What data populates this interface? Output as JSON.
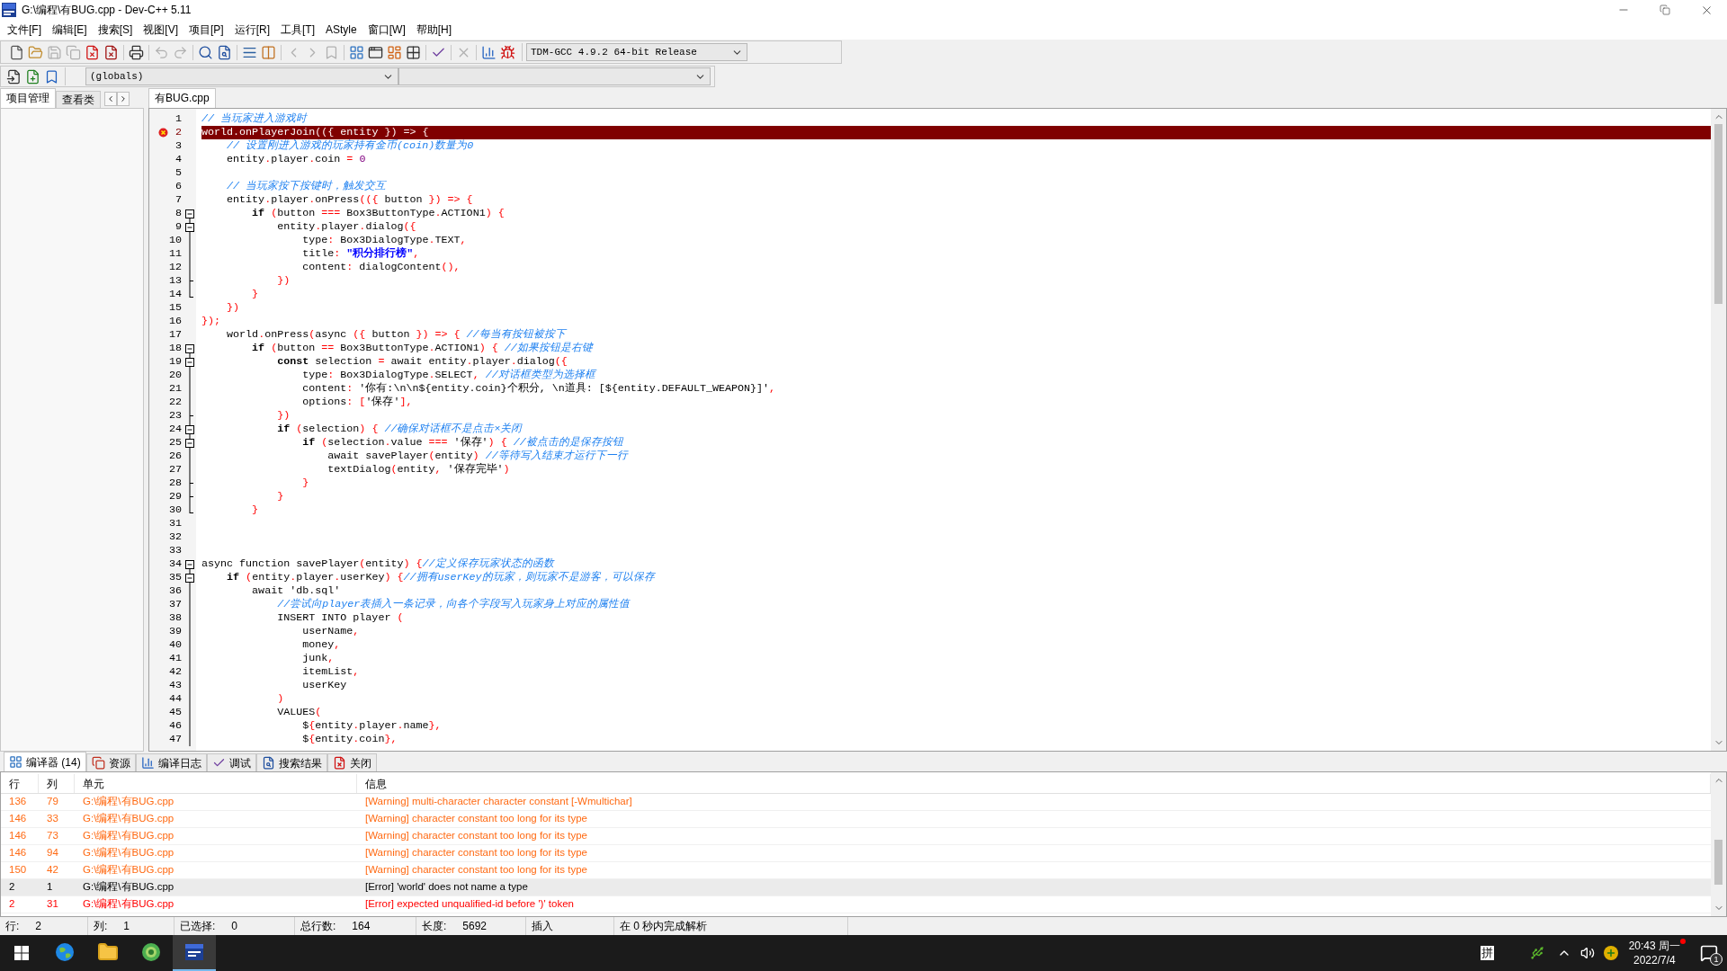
{
  "window": {
    "title": "G:\\编程\\有BUG.cpp - Dev-C++ 5.11"
  },
  "menu": [
    "文件[F]",
    "编辑[E]",
    "搜索[S]",
    "视图[V]",
    "项目[P]",
    "运行[R]",
    "工具[T]",
    "AStyle",
    "窗口[W]",
    "帮助[H]"
  ],
  "toolbar_1": [
    [
      {
        "kind": "new",
        "disabled": false
      },
      {
        "kind": "open",
        "disabled": false
      },
      {
        "kind": "save",
        "disabled": true
      },
      {
        "kind": "save-all",
        "disabled": true
      },
      {
        "kind": "close",
        "disabled": false
      },
      {
        "kind": "close-all",
        "disabled": false
      }
    ],
    [
      {
        "kind": "print",
        "disabled": false
      }
    ],
    [
      {
        "kind": "undo",
        "disabled": true
      },
      {
        "kind": "redo",
        "disabled": true
      }
    ],
    [
      {
        "kind": "find",
        "disabled": false
      },
      {
        "kind": "replace",
        "disabled": false
      }
    ],
    [
      {
        "kind": "indent",
        "disabled": false
      },
      {
        "kind": "unindent",
        "disabled": false
      }
    ],
    [
      {
        "kind": "prev",
        "disabled": true
      },
      {
        "kind": "next",
        "disabled": true
      },
      {
        "kind": "bookmark",
        "disabled": true
      }
    ],
    [
      {
        "kind": "grid",
        "disabled": false
      },
      {
        "kind": "window",
        "disabled": false
      },
      {
        "kind": "dashboard",
        "disabled": false
      },
      {
        "kind": "tiles",
        "disabled": false
      }
    ],
    [
      {
        "kind": "check",
        "disabled": false
      }
    ],
    [
      {
        "kind": "delete",
        "disabled": true
      }
    ],
    [
      {
        "kind": "chart",
        "disabled": false
      },
      {
        "kind": "stop",
        "disabled": false
      }
    ]
  ],
  "compiler_select": {
    "value": "TDM-GCC 4.9.2 64-bit Release"
  },
  "toolbar_2": [
    {
      "kind": "insert",
      "disabled": false
    },
    {
      "kind": "toggle-bookmark",
      "disabled": false
    },
    {
      "kind": "goto-bookmark",
      "disabled": false
    }
  ],
  "scope_select": {
    "value": "(globals)"
  },
  "left_panel": {
    "tabs": [
      {
        "label": "项目管理",
        "selected": true
      },
      {
        "label": "查看类",
        "selected": false
      }
    ]
  },
  "editor_tabs": [
    {
      "label": "有BUG.cpp",
      "selected": true
    }
  ],
  "editor": {
    "lines": [
      {
        "number": "1",
        "kind": "plain",
        "error": false,
        "segments": [
          {
            "kind": "comment",
            "text": "// 当玩家进入游戏时"
          }
        ]
      },
      {
        "number": "2",
        "kind": "plain",
        "error": true,
        "segments": [
          {
            "kind": "text",
            "text": "world"
          },
          {
            "kind": "punct",
            "text": "."
          },
          {
            "kind": "text",
            "text": "onPlayerJoin"
          },
          {
            "kind": "punct",
            "text": "(({"
          },
          {
            "kind": "text",
            "text": " entity "
          },
          {
            "kind": "punct",
            "text": "}) => {"
          }
        ]
      },
      {
        "number": "3",
        "kind": "plain",
        "error": false,
        "segments": [
          {
            "kind": "comment",
            "text": "    // 设置刚进入游戏的玩家持有金币(coin)数量为0"
          }
        ]
      },
      {
        "number": "4",
        "kind": "plain",
        "error": false,
        "segments": [
          {
            "kind": "text",
            "text": "    entity"
          },
          {
            "kind": "punct",
            "text": "."
          },
          {
            "kind": "text",
            "text": "player"
          },
          {
            "kind": "punct",
            "text": "."
          },
          {
            "kind": "text",
            "text": "coin "
          },
          {
            "kind": "punct",
            "text": "= "
          },
          {
            "kind": "number",
            "text": "0"
          }
        ]
      },
      {
        "number": "5",
        "kind": "plain",
        "error": false
      },
      {
        "number": "6",
        "kind": "plain",
        "error": false,
        "segments": [
          {
            "kind": "comment",
            "text": "    // 当玩家按下按键时，触发交互"
          }
        ]
      },
      {
        "number": "7",
        "kind": "plain",
        "error": false,
        "segments": [
          {
            "kind": "text",
            "text": "    entity"
          },
          {
            "kind": "punct",
            "text": "."
          },
          {
            "kind": "text",
            "text": "player"
          },
          {
            "kind": "punct",
            "text": "."
          },
          {
            "kind": "text",
            "text": "onPress"
          },
          {
            "kind": "punct",
            "text": "(({"
          },
          {
            "kind": "text",
            "text": " button "
          },
          {
            "kind": "punct",
            "text": "}) => {"
          }
        ]
      },
      {
        "number": "8",
        "kind": "fold-start",
        "error": false,
        "segments": [
          {
            "kind": "keyword",
            "text": "        if"
          },
          {
            "kind": "punct",
            "text": " ("
          },
          {
            "kind": "text",
            "text": "button "
          },
          {
            "kind": "punct",
            "text": "==="
          },
          {
            "kind": "text",
            "text": " Box3ButtonType"
          },
          {
            "kind": "punct",
            "text": "."
          },
          {
            "kind": "text",
            "text": "ACTION1"
          },
          {
            "kind": "punct",
            "text": ") {"
          }
        ]
      },
      {
        "number": "9",
        "kind": "fold-nested-start",
        "error": false,
        "segments": [
          {
            "kind": "text",
            "text": "            entity"
          },
          {
            "kind": "punct",
            "text": "."
          },
          {
            "kind": "text",
            "text": "player"
          },
          {
            "kind": "punct",
            "text": "."
          },
          {
            "kind": "text",
            "text": "dialog"
          },
          {
            "kind": "punct",
            "text": "({"
          }
        ]
      },
      {
        "number": "10",
        "kind": "fold-line",
        "error": false,
        "segments": [
          {
            "kind": "text",
            "text": "                type"
          },
          {
            "kind": "punct",
            "text": ":"
          },
          {
            "kind": "text",
            "text": " Box3DialogType"
          },
          {
            "kind": "punct",
            "text": "."
          },
          {
            "kind": "text",
            "text": "TEXT"
          },
          {
            "kind": "punct",
            "text": ","
          }
        ]
      },
      {
        "number": "11",
        "kind": "fold-line",
        "error": false,
        "segments": [
          {
            "kind": "text",
            "text": "                title"
          },
          {
            "kind": "punct",
            "text": ":"
          },
          {
            "kind": "string",
            "text": " \"积分排行榜\""
          },
          {
            "kind": "punct",
            "text": ","
          }
        ]
      },
      {
        "number": "12",
        "kind": "fold-line",
        "error": false,
        "segments": [
          {
            "kind": "text",
            "text": "                content"
          },
          {
            "kind": "punct",
            "text": ":"
          },
          {
            "kind": "text",
            "text": " dialogContent"
          },
          {
            "kind": "punct",
            "text": "(),"
          }
        ]
      },
      {
        "number": "13",
        "kind": "fold-tee",
        "error": false,
        "segments": [
          {
            "kind": "punct",
            "text": "            })"
          }
        ]
      },
      {
        "number": "14",
        "kind": "fold-end",
        "error": false,
        "segments": [
          {
            "kind": "punct",
            "text": "        }"
          }
        ]
      },
      {
        "number": "15",
        "kind": "plain",
        "error": false,
        "segments": [
          {
            "kind": "punct",
            "text": "    })"
          }
        ]
      },
      {
        "number": "16",
        "kind": "plain",
        "error": false,
        "segments": [
          {
            "kind": "punct",
            "text": "});"
          }
        ]
      },
      {
        "number": "17",
        "kind": "plain",
        "error": false,
        "segments": [
          {
            "kind": "text",
            "text": "    world"
          },
          {
            "kind": "punct",
            "text": "."
          },
          {
            "kind": "text",
            "text": "onPress"
          },
          {
            "kind": "punct",
            "text": "("
          },
          {
            "kind": "text",
            "text": "async "
          },
          {
            "kind": "punct",
            "text": "({"
          },
          {
            "kind": "text",
            "text": " button "
          },
          {
            "kind": "punct",
            "text": "}) => { "
          },
          {
            "kind": "comment",
            "text": "//每当有按钮被按下"
          }
        ]
      },
      {
        "number": "18",
        "kind": "fold-start",
        "error": false,
        "segments": [
          {
            "kind": "keyword",
            "text": "        if"
          },
          {
            "kind": "punct",
            "text": " ("
          },
          {
            "kind": "text",
            "text": "button "
          },
          {
            "kind": "punct",
            "text": "=="
          },
          {
            "kind": "text",
            "text": " Box3ButtonType"
          },
          {
            "kind": "punct",
            "text": "."
          },
          {
            "kind": "text",
            "text": "ACTION1"
          },
          {
            "kind": "punct",
            "text": ") { "
          },
          {
            "kind": "comment",
            "text": "//如果按钮是右键"
          }
        ]
      },
      {
        "number": "19",
        "kind": "fold-nested-start",
        "error": false,
        "segments": [
          {
            "kind": "keyword",
            "text": "            const"
          },
          {
            "kind": "text",
            "text": " selection "
          },
          {
            "kind": "punct",
            "text": "="
          },
          {
            "kind": "text",
            "text": " await entity"
          },
          {
            "kind": "punct",
            "text": "."
          },
          {
            "kind": "text",
            "text": "player"
          },
          {
            "kind": "punct",
            "text": "."
          },
          {
            "kind": "text",
            "text": "dialog"
          },
          {
            "kind": "punct",
            "text": "({"
          }
        ]
      },
      {
        "number": "20",
        "kind": "fold-line",
        "error": false,
        "segments": [
          {
            "kind": "text",
            "text": "                type"
          },
          {
            "kind": "punct",
            "text": ":"
          },
          {
            "kind": "text",
            "text": " Box3DialogType"
          },
          {
            "kind": "punct",
            "text": "."
          },
          {
            "kind": "text",
            "text": "SELECT"
          },
          {
            "kind": "punct",
            "text": ", "
          },
          {
            "kind": "comment",
            "text": "//对话框类型为选择框"
          }
        ]
      },
      {
        "number": "21",
        "kind": "fold-line",
        "error": false,
        "segments": [
          {
            "kind": "text",
            "text": "                content"
          },
          {
            "kind": "punct",
            "text": ":"
          },
          {
            "kind": "text",
            "text": " '你有:\\n\\n${entity.coin}个积分, \\n道具: [${entity.DEFAULT_WEAPON}]'"
          },
          {
            "kind": "punct",
            "text": ","
          }
        ]
      },
      {
        "number": "22",
        "kind": "fold-line",
        "error": false,
        "segments": [
          {
            "kind": "text",
            "text": "                options"
          },
          {
            "kind": "punct",
            "text": ": ["
          },
          {
            "kind": "text",
            "text": "'保存'"
          },
          {
            "kind": "punct",
            "text": "],"
          }
        ]
      },
      {
        "number": "23",
        "kind": "fold-tee",
        "error": false,
        "segments": [
          {
            "kind": "punct",
            "text": "            })"
          }
        ]
      },
      {
        "number": "24",
        "kind": "fold-nested-start",
        "error": false,
        "segments": [
          {
            "kind": "keyword",
            "text": "            if"
          },
          {
            "kind": "punct",
            "text": " ("
          },
          {
            "kind": "text",
            "text": "selection"
          },
          {
            "kind": "punct",
            "text": ") { "
          },
          {
            "kind": "comment",
            "text": "//确保对话框不是点击×关闭"
          }
        ]
      },
      {
        "number": "25",
        "kind": "fold-nested-start",
        "error": false,
        "segments": [
          {
            "kind": "keyword",
            "text": "                if"
          },
          {
            "kind": "punct",
            "text": " ("
          },
          {
            "kind": "text",
            "text": "selection"
          },
          {
            "kind": "punct",
            "text": "."
          },
          {
            "kind": "text",
            "text": "value "
          },
          {
            "kind": "punct",
            "text": "==="
          },
          {
            "kind": "text",
            "text": " '保存'"
          },
          {
            "kind": "punct",
            "text": ") { "
          },
          {
            "kind": "comment",
            "text": "//被点击的是保存按钮"
          }
        ]
      },
      {
        "number": "26",
        "kind": "fold-line",
        "error": false,
        "segments": [
          {
            "kind": "text",
            "text": "                    await savePlayer"
          },
          {
            "kind": "punct",
            "text": "("
          },
          {
            "kind": "text",
            "text": "entity"
          },
          {
            "kind": "punct",
            "text": ") "
          },
          {
            "kind": "comment",
            "text": "//等待写入结束才运行下一行"
          }
        ]
      },
      {
        "number": "27",
        "kind": "fold-line",
        "error": false,
        "segments": [
          {
            "kind": "text",
            "text": "                    textDialog"
          },
          {
            "kind": "punct",
            "text": "("
          },
          {
            "kind": "text",
            "text": "entity"
          },
          {
            "kind": "punct",
            "text": ","
          },
          {
            "kind": "text",
            "text": " '保存完毕'"
          },
          {
            "kind": "punct",
            "text": ")"
          }
        ]
      },
      {
        "number": "28",
        "kind": "fold-tee",
        "error": false,
        "segments": [
          {
            "kind": "punct",
            "text": "                }"
          }
        ]
      },
      {
        "number": "29",
        "kind": "fold-tee",
        "error": false,
        "segments": [
          {
            "kind": "punct",
            "text": "            }"
          }
        ]
      },
      {
        "number": "30",
        "kind": "fold-end",
        "error": false,
        "segments": [
          {
            "kind": "punct",
            "text": "        }"
          }
        ]
      },
      {
        "number": "31",
        "kind": "plain",
        "error": false
      },
      {
        "number": "32",
        "kind": "plain",
        "error": false
      },
      {
        "number": "33",
        "kind": "plain",
        "error": false
      },
      {
        "number": "34",
        "kind": "fold-start",
        "error": false,
        "segments": [
          {
            "kind": "text",
            "text": "async function savePlayer"
          },
          {
            "kind": "punct",
            "text": "("
          },
          {
            "kind": "text",
            "text": "entity"
          },
          {
            "kind": "punct",
            "text": ") {"
          },
          {
            "kind": "comment",
            "text": "//定义保存玩家状态的函数"
          }
        ]
      },
      {
        "number": "35",
        "kind": "fold-nested-start",
        "error": false,
        "segments": [
          {
            "kind": "keyword",
            "text": "    if"
          },
          {
            "kind": "punct",
            "text": " ("
          },
          {
            "kind": "text",
            "text": "entity"
          },
          {
            "kind": "punct",
            "text": "."
          },
          {
            "kind": "text",
            "text": "player"
          },
          {
            "kind": "punct",
            "text": "."
          },
          {
            "kind": "text",
            "text": "userKey"
          },
          {
            "kind": "punct",
            "text": ") {"
          },
          {
            "kind": "comment",
            "text": "//拥有userKey的玩家，则玩家不是游客，可以保存"
          }
        ]
      },
      {
        "number": "36",
        "kind": "fold-line",
        "error": false,
        "segments": [
          {
            "kind": "text",
            "text": "        await 'db.sql'"
          }
        ]
      },
      {
        "number": "37",
        "kind": "fold-line",
        "error": false,
        "segments": [
          {
            "kind": "comment",
            "text": "            //尝试向player表插入一条记录，向各个字段写入玩家身上对应的属性值"
          }
        ]
      },
      {
        "number": "38",
        "kind": "fold-line",
        "error": false,
        "segments": [
          {
            "kind": "text",
            "text": "            INSERT INTO player "
          },
          {
            "kind": "punct",
            "text": "("
          }
        ]
      },
      {
        "number": "39",
        "kind": "fold-line",
        "error": false,
        "segments": [
          {
            "kind": "text",
            "text": "                userName"
          },
          {
            "kind": "punct",
            "text": ","
          }
        ]
      },
      {
        "number": "40",
        "kind": "fold-line",
        "error": false,
        "segments": [
          {
            "kind": "text",
            "text": "                money"
          },
          {
            "kind": "punct",
            "text": ","
          }
        ]
      },
      {
        "number": "41",
        "kind": "fold-line",
        "error": false,
        "segments": [
          {
            "kind": "text",
            "text": "                junk"
          },
          {
            "kind": "punct",
            "text": ","
          }
        ]
      },
      {
        "number": "42",
        "kind": "fold-line",
        "error": false,
        "segments": [
          {
            "kind": "text",
            "text": "                itemList"
          },
          {
            "kind": "punct",
            "text": ","
          }
        ]
      },
      {
        "number": "43",
        "kind": "fold-line",
        "error": false,
        "segments": [
          {
            "kind": "text",
            "text": "                userKey"
          }
        ]
      },
      {
        "number": "44",
        "kind": "fold-line",
        "error": false,
        "segments": [
          {
            "kind": "punct",
            "text": "            )"
          }
        ]
      },
      {
        "number": "45",
        "kind": "fold-line",
        "error": false,
        "segments": [
          {
            "kind": "text",
            "text": "            VALUES"
          },
          {
            "kind": "punct",
            "text": "("
          }
        ]
      },
      {
        "number": "46",
        "kind": "fold-line",
        "error": false,
        "segments": [
          {
            "kind": "text",
            "text": "                $"
          },
          {
            "kind": "punct",
            "text": "{"
          },
          {
            "kind": "text",
            "text": "entity"
          },
          {
            "kind": "punct",
            "text": "."
          },
          {
            "kind": "text",
            "text": "player"
          },
          {
            "kind": "punct",
            "text": "."
          },
          {
            "kind": "text",
            "text": "name"
          },
          {
            "kind": "punct",
            "text": "},"
          }
        ]
      },
      {
        "number": "47",
        "kind": "fold-line",
        "error": false,
        "segments": [
          {
            "kind": "text",
            "text": "                $"
          },
          {
            "kind": "punct",
            "text": "{"
          },
          {
            "kind": "text",
            "text": "entity"
          },
          {
            "kind": "punct",
            "text": "."
          },
          {
            "kind": "text",
            "text": "coin"
          },
          {
            "kind": "punct",
            "text": "},"
          }
        ]
      }
    ]
  },
  "bottom_tabs": [
    {
      "kind": "compiler",
      "label": "编译器 (14)",
      "selected": true
    },
    {
      "kind": "resources",
      "label": "资源",
      "selected": false
    },
    {
      "kind": "log",
      "label": "编译日志",
      "selected": false
    },
    {
      "kind": "debug",
      "label": "调试",
      "selected": false
    },
    {
      "kind": "search",
      "label": "搜索结果",
      "selected": false
    },
    {
      "kind": "close",
      "label": "关闭",
      "selected": false
    }
  ],
  "messages": {
    "columns": [
      "行",
      "列",
      "单元",
      "信息"
    ],
    "rows": [
      {
        "line": "136",
        "col": "79",
        "unit": "G:\\编程\\有BUG.cpp",
        "message": "[Warning] multi-character character constant [-Wmultichar]",
        "kind": "warning",
        "selected": false
      },
      {
        "line": "146",
        "col": "33",
        "unit": "G:\\编程\\有BUG.cpp",
        "message": "[Warning] character constant too long for its type",
        "kind": "warning",
        "selected": false
      },
      {
        "line": "146",
        "col": "73",
        "unit": "G:\\编程\\有BUG.cpp",
        "message": "[Warning] character constant too long for its type",
        "kind": "warning",
        "selected": false
      },
      {
        "line": "146",
        "col": "94",
        "unit": "G:\\编程\\有BUG.cpp",
        "message": "[Warning] character constant too long for its type",
        "kind": "warning",
        "selected": false
      },
      {
        "line": "150",
        "col": "42",
        "unit": "G:\\编程\\有BUG.cpp",
        "message": "[Warning] character constant too long for its type",
        "kind": "warning",
        "selected": false
      },
      {
        "line": "2",
        "col": "1",
        "unit": "G:\\编程\\有BUG.cpp",
        "message": "[Error] 'world' does not name a type",
        "kind": "error",
        "selected": true
      },
      {
        "line": "2",
        "col": "31",
        "unit": "G:\\编程\\有BUG.cpp",
        "message": "[Error] expected unqualified-id before ')' token",
        "kind": "error",
        "selected": false
      }
    ]
  },
  "status_bar": [
    {
      "label": "行:",
      "value": "2"
    },
    {
      "label": "列:",
      "value": "1"
    },
    {
      "label": "已选择:",
      "value": "0"
    },
    {
      "label": "总行数:",
      "value": "164"
    },
    {
      "label": "长度:",
      "value": "5692"
    },
    {
      "label": "插入"
    },
    {
      "label": "在 0 秒内完成解析"
    }
  ],
  "taskbar": {
    "apps": [
      {
        "kind": "browser",
        "active": false
      },
      {
        "kind": "files",
        "active": false
      },
      {
        "kind": "security",
        "active": false
      },
      {
        "kind": "ide",
        "active": true
      }
    ],
    "input_method": "拼",
    "time": "20:43 周一",
    "date": "2022/7/4",
    "notification_count": "1"
  }
}
